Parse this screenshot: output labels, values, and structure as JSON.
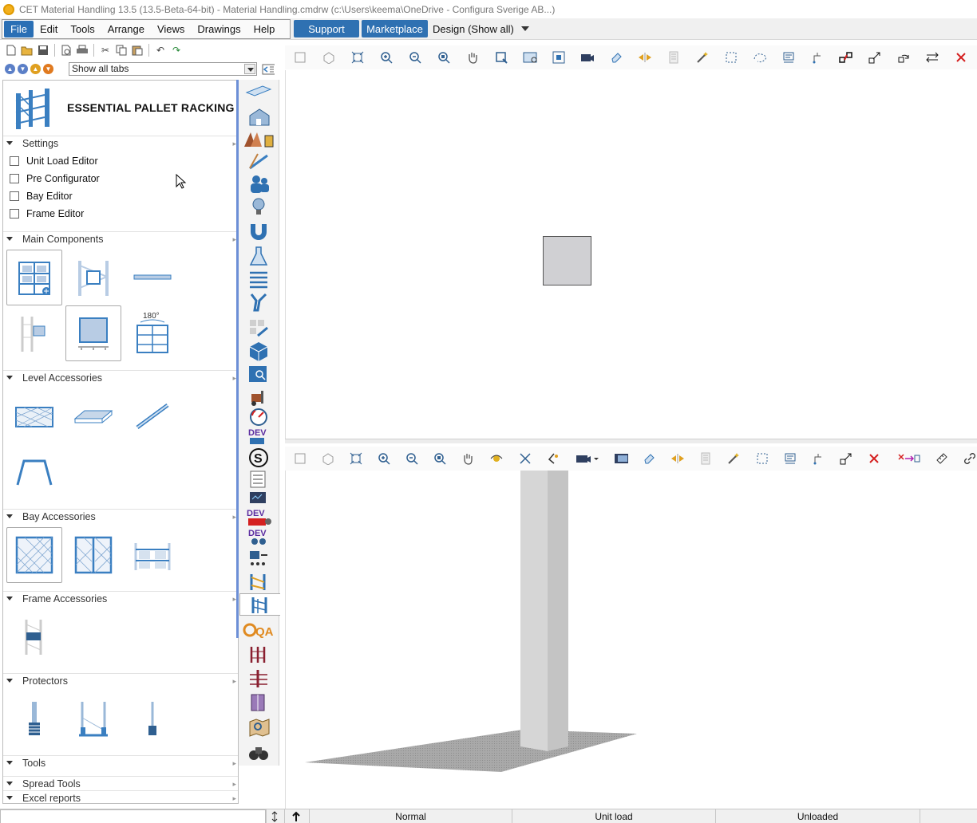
{
  "window": {
    "title": "CET Material Handling 13.5 (13.5-Beta-64-bit) - Material Handling.cmdrw (c:\\Users\\keema\\OneDrive - Configura Sverige AB...)"
  },
  "menubar": {
    "items": [
      "File",
      "Edit",
      "Tools",
      "Arrange",
      "Views",
      "Drawings",
      "Help"
    ],
    "support_label": "Support",
    "marketplace_label": "Marketplace",
    "design_label": "Design (Show all)"
  },
  "left_panel": {
    "tabs_select_value": "Show all tabs",
    "title": "ESSENTIAL PALLET RACKING",
    "sections": {
      "settings": "Settings",
      "main_components": "Main Components",
      "level_accessories": "Level Accessories",
      "bay_accessories": "Bay Accessories",
      "frame_accessories": "Frame Accessories",
      "protectors": "Protectors",
      "tools": "Tools",
      "spread_tools": "Spread Tools",
      "excel_reports": "Excel reports"
    },
    "settings_items": [
      "Unit Load Editor",
      "Pre Configurator",
      "Bay Editor",
      "Frame Editor"
    ],
    "rotate_label": "180°"
  },
  "tabstrip": {
    "dev_label": "DEV",
    "qa_label": "QA"
  },
  "statusbar": {
    "mode": "Normal",
    "unit_load": "Unit load",
    "unloaded": "Unloaded"
  },
  "colors": {
    "accent": "#2f71b2",
    "rack_blue": "#3a7fc1",
    "dev_purple": "#5a2ca0",
    "close_red": "#d42020"
  }
}
